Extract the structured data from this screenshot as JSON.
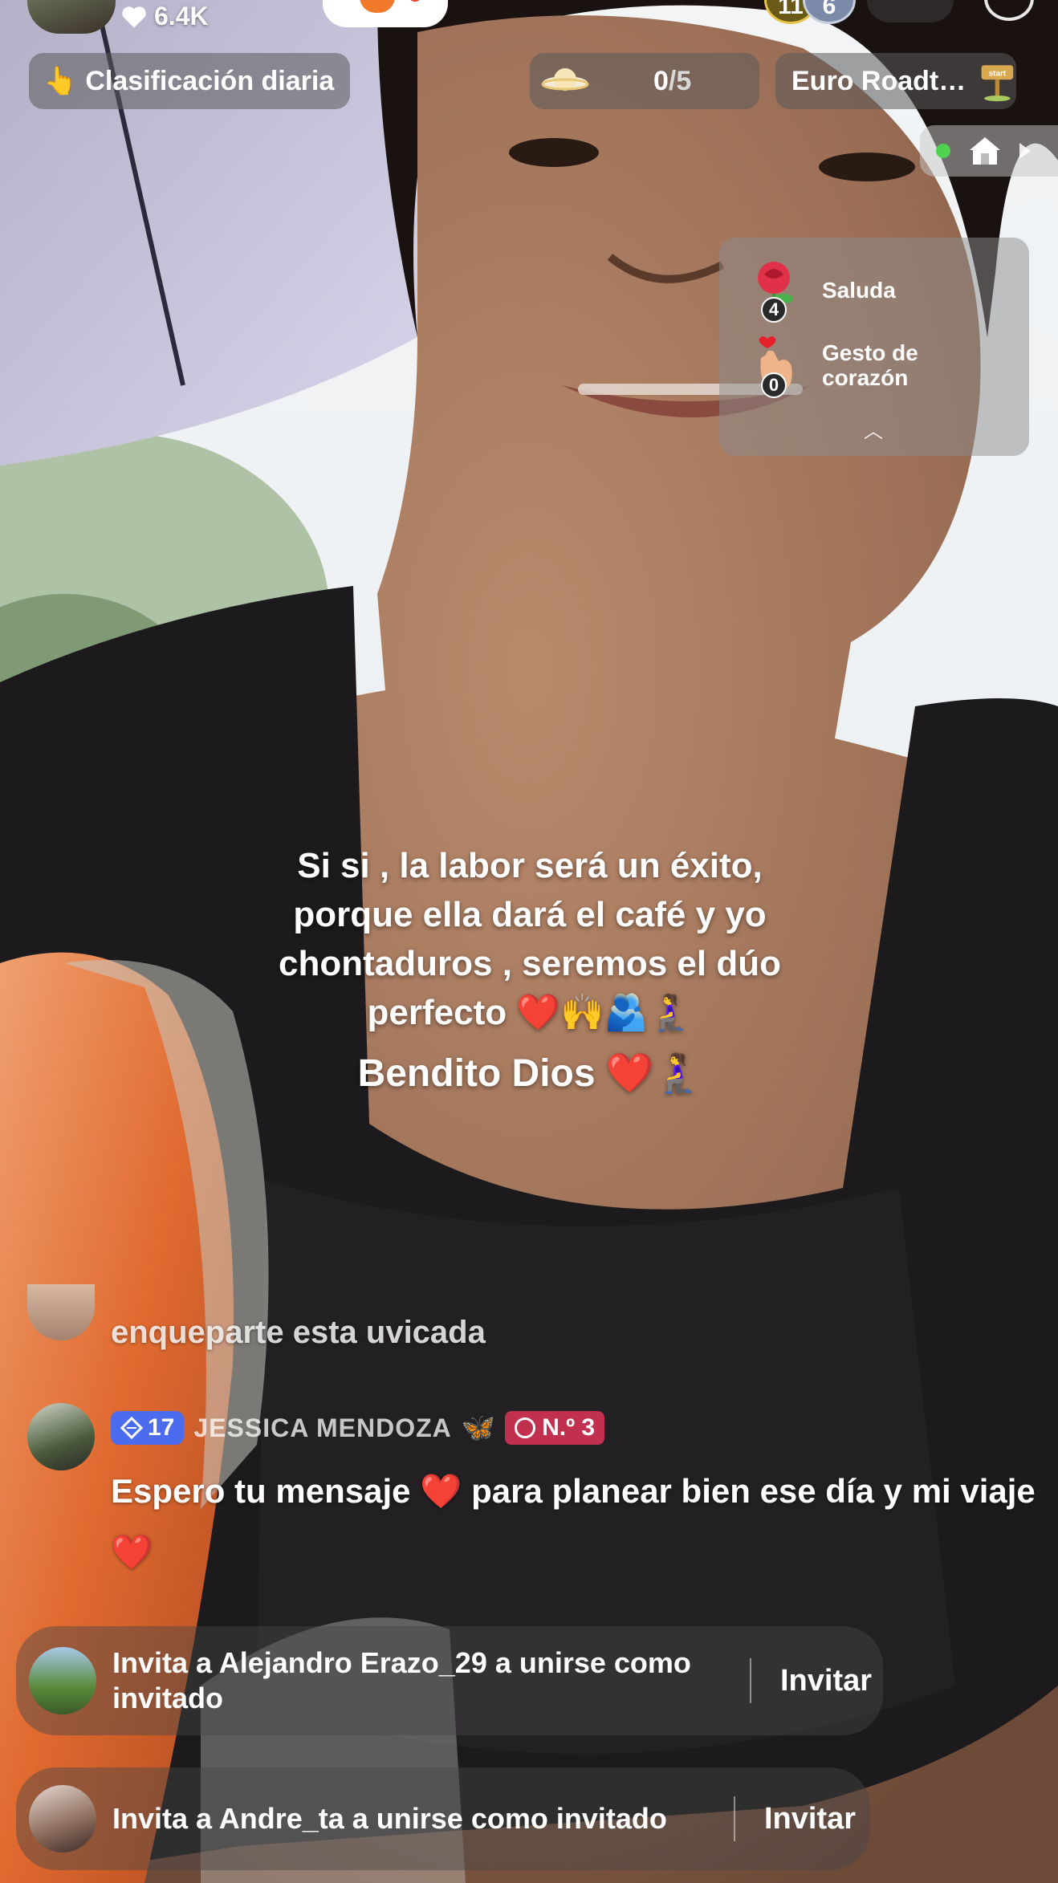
{
  "header": {
    "likes": "6.4K",
    "viewer_badges": [
      "11",
      "6"
    ]
  },
  "pills": {
    "ranking_icon": "👆",
    "ranking_label": "Clasificación diaria",
    "progress_current": "0",
    "progress_max": "/5",
    "event_label": "Euro Roadt…",
    "event_icon_text": "start"
  },
  "gifts": [
    {
      "icon": "rose-icon",
      "count": "4",
      "label": "Saluda"
    },
    {
      "icon": "finger-heart-icon",
      "count": "0",
      "label": "Gesto de corazón"
    }
  ],
  "caption": {
    "lines": [
      "Si si , la labor será un éxito,",
      "porque ella dará el café y yo",
      "chontaduros , seremos el dúo",
      "perfecto ❤️🙌🫂🧎‍♀️"
    ],
    "line2": "Bendito Dios ❤️🧎‍♀️"
  },
  "chat": {
    "previous_message": "enqueparte esta uvicada",
    "message": {
      "level": "17",
      "username": "JESSICA MENDOZA",
      "username_emoji": "🦋",
      "rank": "N.º 3",
      "text_1": "Espero tu mensaje ",
      "heart": "❤️",
      "text_2": " para planear bien ese día y mi viaje "
    }
  },
  "invites": [
    {
      "text": "Invita a Alejandro Erazo_29 a unirse como invitado",
      "button": "Invitar"
    },
    {
      "text": "Invita a Andre_ta a unirse como invitado",
      "button": "Invitar"
    }
  ],
  "colors": {
    "level_badge": "#4c6cf0",
    "rank_badge": "#c23050",
    "accent_orange": "#f07a2a",
    "online_dot": "#4fd24f"
  }
}
